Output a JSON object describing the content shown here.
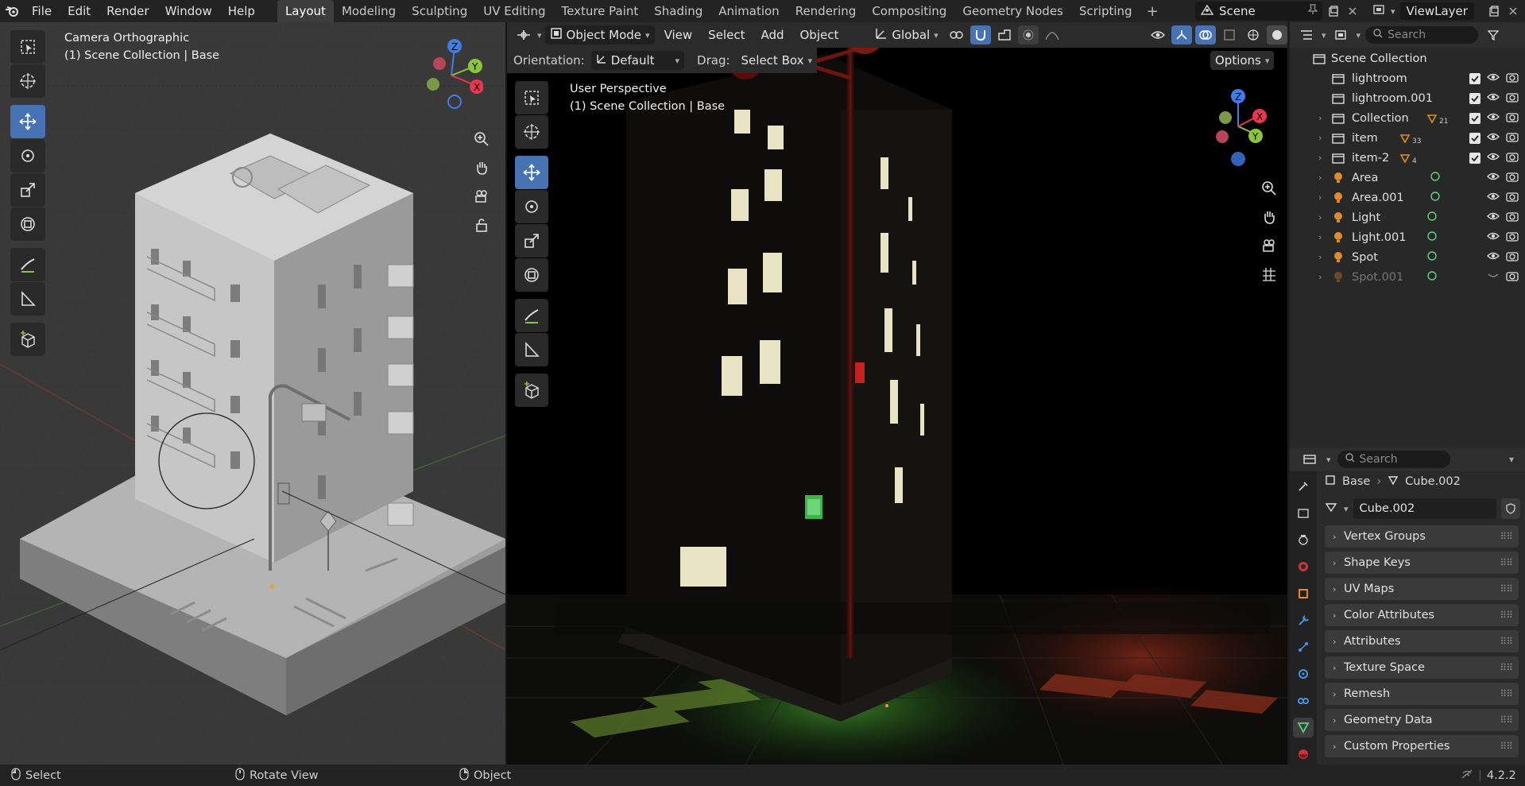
{
  "topbar": {
    "menus": [
      "File",
      "Edit",
      "Render",
      "Window",
      "Help"
    ],
    "workspaces": [
      "Layout",
      "Modeling",
      "Sculpting",
      "UV Editing",
      "Texture Paint",
      "Shading",
      "Animation",
      "Rendering",
      "Compositing",
      "Geometry Nodes",
      "Scripting"
    ],
    "active_workspace": "Layout",
    "add_workspace": "+",
    "scene_name": "Scene",
    "view_layer_name": "ViewLayer"
  },
  "left_viewport": {
    "view_name": "Camera Orthographic",
    "collection_info": "(1) Scene Collection | Base",
    "gizmo_axes": {
      "z": "Z",
      "y": "Y",
      "x": "X"
    }
  },
  "right_viewport": {
    "header": {
      "mode": "Object Mode",
      "menus": [
        "View",
        "Select",
        "Add",
        "Object"
      ],
      "transform_orientation": "Global",
      "orientation_label": "Orientation:",
      "orientation_value": "Default",
      "drag_label": "Drag:",
      "drag_value": "Select Box",
      "options_label": "Options"
    },
    "view_name": "User Perspective",
    "collection_info": "(1) Scene Collection | Base",
    "gizmo_axes": {
      "z": "Z",
      "y": "Y",
      "x": "X"
    }
  },
  "outliner": {
    "search_placeholder": "Search",
    "root": "Scene Collection",
    "items": [
      {
        "name": "lightroom",
        "type": "collection",
        "expandable": false,
        "checked": true,
        "badge": ""
      },
      {
        "name": "lightroom.001",
        "type": "collection",
        "expandable": false,
        "checked": true,
        "badge": ""
      },
      {
        "name": "Collection",
        "type": "collection",
        "expandable": true,
        "checked": true,
        "badge": "21"
      },
      {
        "name": "item",
        "type": "collection",
        "expandable": true,
        "checked": true,
        "badge": "33"
      },
      {
        "name": "item-2",
        "type": "collection",
        "expandable": true,
        "checked": true,
        "badge": "4"
      },
      {
        "name": "Area",
        "type": "light",
        "expandable": true,
        "checked": false,
        "badge": ""
      },
      {
        "name": "Area.001",
        "type": "light",
        "expandable": true,
        "checked": false,
        "badge": ""
      },
      {
        "name": "Light",
        "type": "light",
        "expandable": true,
        "checked": false,
        "badge": ""
      },
      {
        "name": "Light.001",
        "type": "light",
        "expandable": true,
        "checked": false,
        "badge": ""
      },
      {
        "name": "Spot",
        "type": "light",
        "expandable": true,
        "checked": false,
        "badge": ""
      },
      {
        "name": "Spot.001",
        "type": "light",
        "expandable": true,
        "checked": false,
        "badge": "",
        "hidden": true
      }
    ]
  },
  "properties": {
    "search_placeholder": "Search",
    "breadcrumb": [
      "Base",
      "Cube.002"
    ],
    "mesh_name": "Cube.002",
    "panels": [
      "Vertex Groups",
      "Shape Keys",
      "UV Maps",
      "Color Attributes",
      "Attributes",
      "Texture Space",
      "Remesh",
      "Geometry Data",
      "Custom Properties"
    ]
  },
  "statusbar": {
    "select": "Select",
    "rotate": "Rotate View",
    "object": "Object",
    "version": "4.2.2"
  },
  "colors": {
    "accent_blue": "#4772b3",
    "axis_x": "#e8374c",
    "axis_y": "#8bc43f",
    "axis_z": "#3f7de8"
  }
}
